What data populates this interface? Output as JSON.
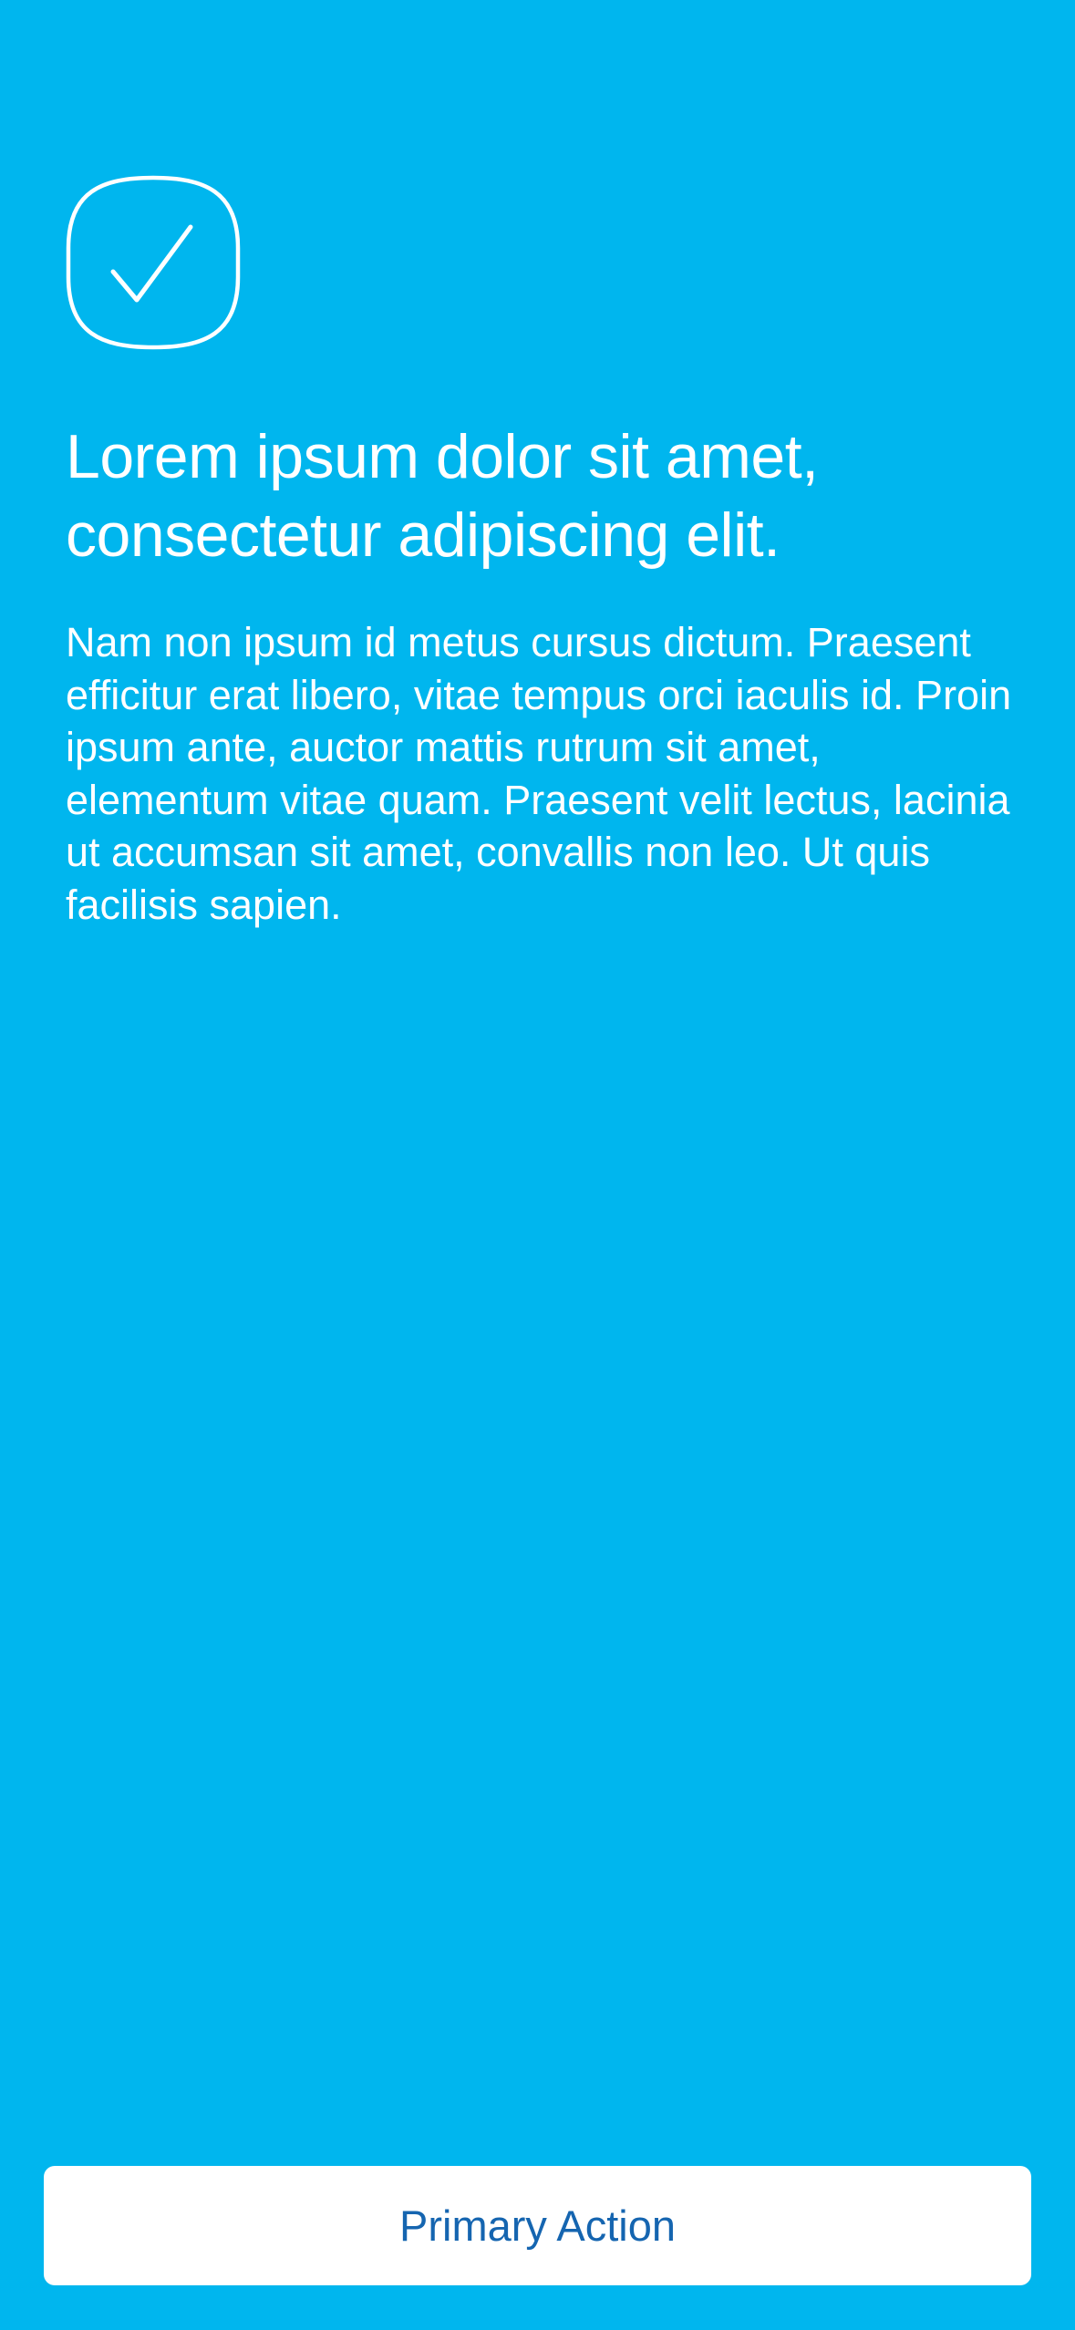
{
  "colors": {
    "background": "#00B6EE",
    "text": "#FFFFFF",
    "button_background": "#FFFFFF",
    "button_text": "#1565B0"
  },
  "hero": {
    "icon": "checkmark-icon",
    "headline": "Lorem ipsum dolor sit amet, consectetur adipiscing elit.",
    "body": "Nam non ipsum id metus cursus dictum. Praesent efficitur erat libero, vitae tempus orci iaculis id. Proin ipsum ante, auctor mattis rutrum sit amet, elementum vitae quam. Praesent velit lectus, lacinia ut accumsan sit amet, convallis non leo. Ut quis facilisis sapien."
  },
  "actions": {
    "primary_label": "Primary Action"
  }
}
